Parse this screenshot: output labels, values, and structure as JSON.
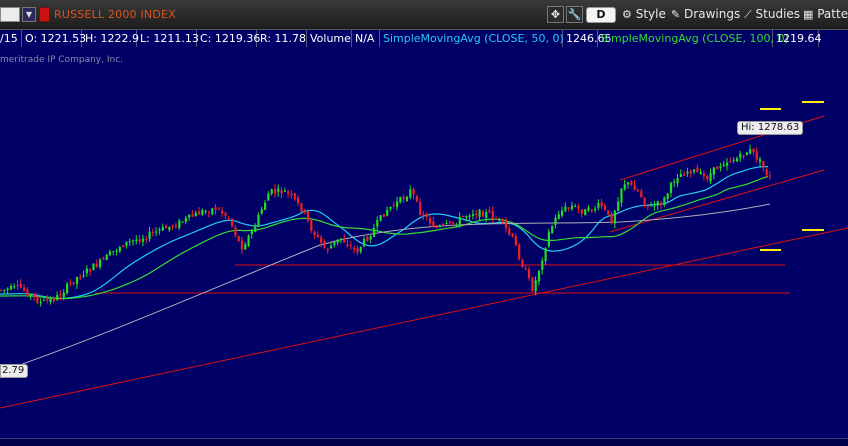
{
  "toolbar": {
    "symbol_value": "",
    "symbol_name": "RUSSELL 2000 INDEX",
    "period": "D",
    "style_label": "Style",
    "drawings_label": "Drawings",
    "studies_label": "Studies",
    "patterns_label": "Patte"
  },
  "info": {
    "date": "/15",
    "open": "O: 1221.53",
    "high": "H: 1222.9",
    "low": "L: 1211.13",
    "close": "C: 1219.36",
    "range": "R: 11.78",
    "volume_label": "Volume",
    "volume_value": "N/A",
    "sma50_label": "SimpleMovingAvg (CLOSE, 50, 0)",
    "sma50_value": "1246.65",
    "sma100_label": "SimpleMovingAvg (CLOSE, 100, 0)",
    "sma100_value": "1219.64"
  },
  "copyright": "meritrade IP Company, Inc.",
  "labels": {
    "hi": "Hi: 1278.63",
    "left_value": "2.79"
  },
  "colors": {
    "background": "#000066",
    "up_candle": "#22dd22",
    "down_candle": "#ee2222",
    "sma50": "#22ccee",
    "sma100": "#33dd33",
    "sma200": "#b0b0b8",
    "trendline": "#dd1111",
    "marker": "#ffee00",
    "symbol_text": "#d8551a"
  },
  "icons": [
    "crosshair-icon",
    "wrench-icon",
    "style-icon",
    "drawings-icon",
    "studies-icon",
    "patterns-icon"
  ]
}
